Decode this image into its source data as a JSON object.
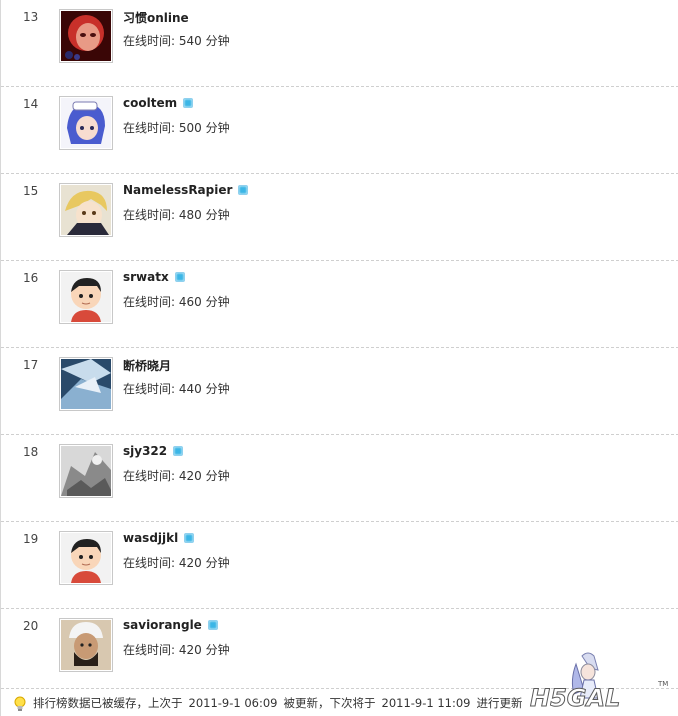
{
  "ranking": [
    {
      "rank": "13",
      "name": "习惯online",
      "online": true,
      "badge": false,
      "time": "在线时间: 540 分钟"
    },
    {
      "rank": "14",
      "name": "cooltem",
      "online": true,
      "badge": true,
      "time": "在线时间: 500 分钟"
    },
    {
      "rank": "15",
      "name": "NamelessRapier",
      "online": true,
      "badge": true,
      "time": "在线时间: 480 分钟"
    },
    {
      "rank": "16",
      "name": "srwatx",
      "online": true,
      "badge": true,
      "time": "在线时间: 460 分钟"
    },
    {
      "rank": "17",
      "name": "断桥晓月",
      "online": true,
      "badge": false,
      "time": "在线时间: 440 分钟"
    },
    {
      "rank": "18",
      "name": "sjy322",
      "online": true,
      "badge": true,
      "time": "在线时间: 420 分钟"
    },
    {
      "rank": "19",
      "name": "wasdjjkl",
      "online": true,
      "badge": true,
      "time": "在线时间: 420 分钟"
    },
    {
      "rank": "20",
      "name": "saviorangle",
      "online": true,
      "badge": true,
      "time": "在线时间: 420 分钟"
    }
  ],
  "footer": {
    "icon": "lightbulb-icon",
    "text_prefix": "排行榜数据已被缓存，上次于",
    "last_update": "2011-9-1 06:09",
    "text_mid": "被更新，下次将于",
    "next_update": "2011-9-1 11:09",
    "text_suffix": "进行更新"
  },
  "watermark": {
    "text": "H5GAL",
    "tm": "TM"
  },
  "colors": {
    "status_dot": "#3bb6e6",
    "divider": "#cfcfcf",
    "text": "#333333"
  }
}
